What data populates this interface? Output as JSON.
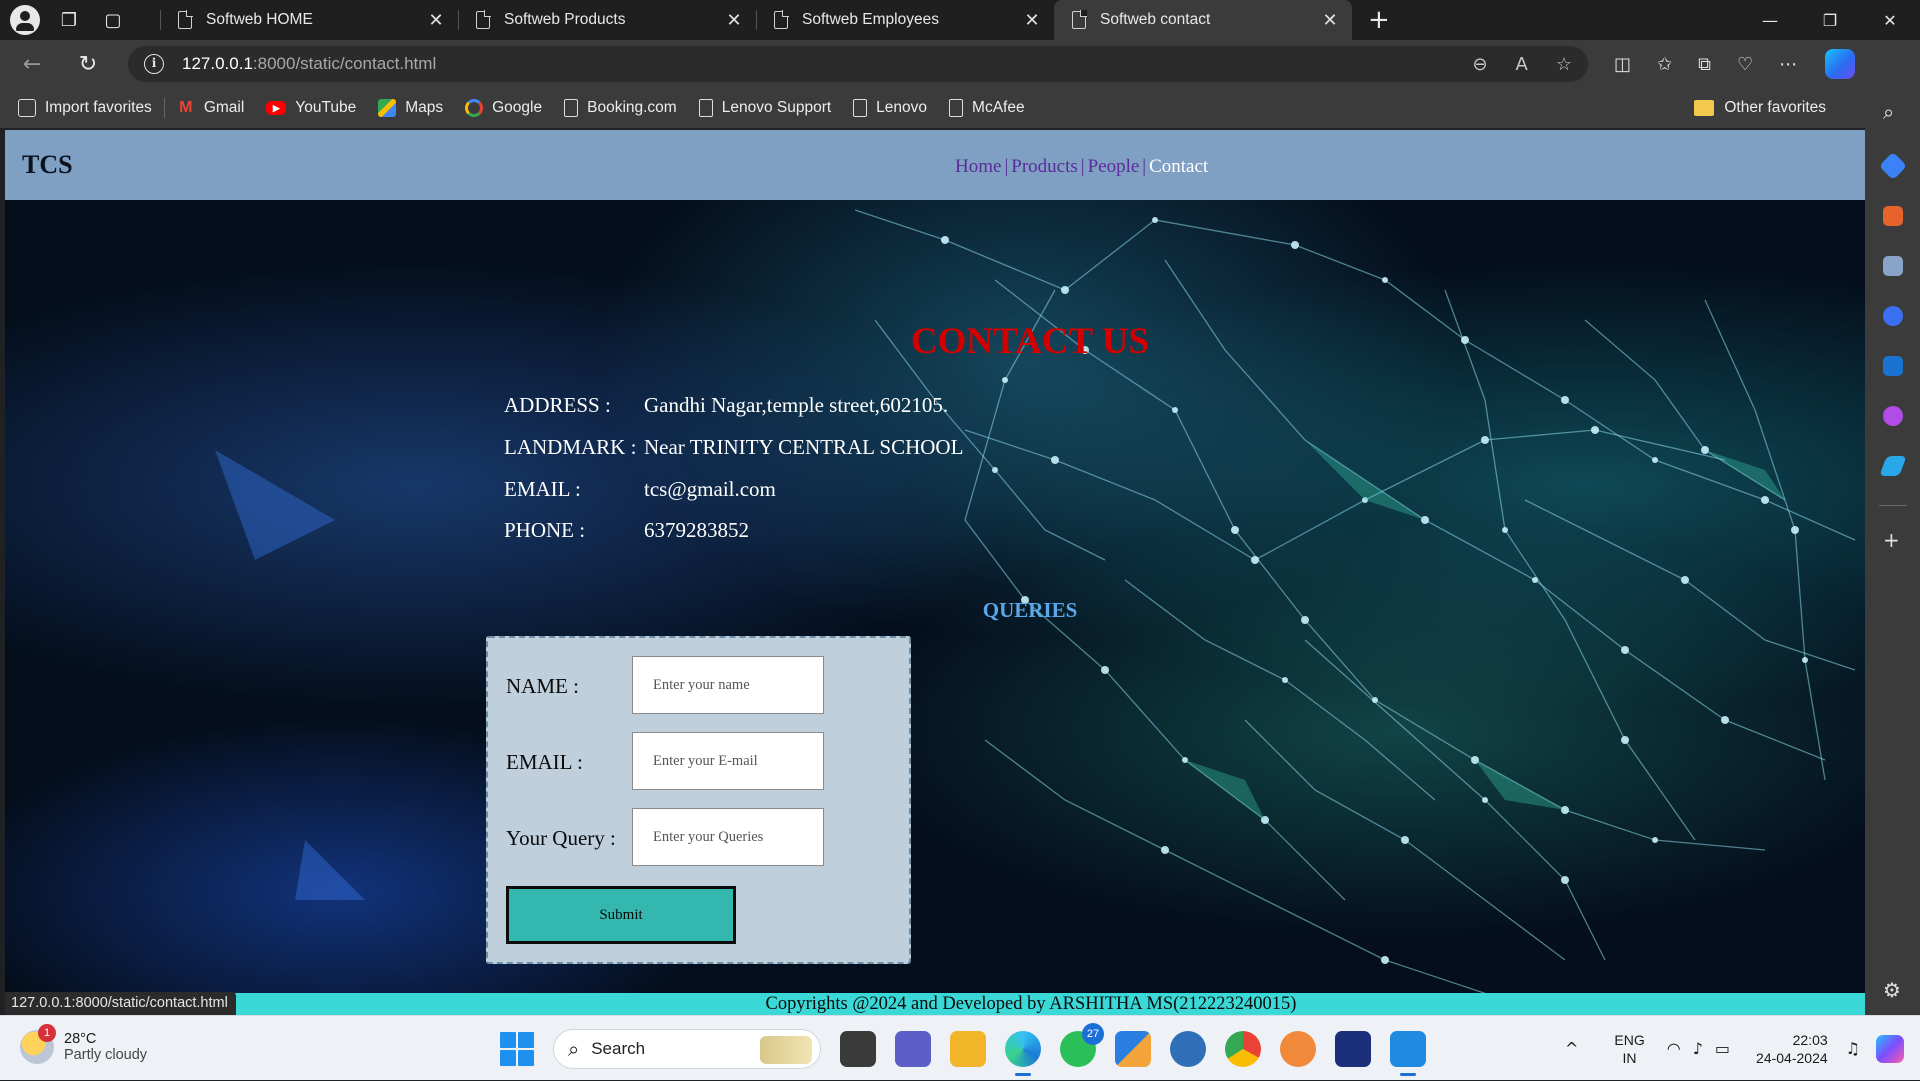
{
  "browser": {
    "tabs": [
      {
        "title": "Softweb HOME"
      },
      {
        "title": "Softweb Products"
      },
      {
        "title": "Softweb Employees"
      },
      {
        "title": "Softweb contact"
      }
    ],
    "url_host": "127.0.0.1",
    "url_path": ":8000/static/contact.html",
    "favorites": [
      {
        "label": "Import favorites",
        "icon": "import-icon"
      },
      {
        "label": "Gmail",
        "icon": "gmail-icon"
      },
      {
        "label": "YouTube",
        "icon": "youtube-icon"
      },
      {
        "label": "Maps",
        "icon": "maps-icon"
      },
      {
        "label": "Google",
        "icon": "google-icon"
      },
      {
        "label": "Booking.com",
        "icon": "page-icon"
      },
      {
        "label": "Lenovo Support",
        "icon": "page-icon"
      },
      {
        "label": "Lenovo",
        "icon": "page-icon"
      },
      {
        "label": "McAfee",
        "icon": "page-icon"
      }
    ],
    "other_favorites": "Other favorites",
    "status_url": "127.0.0.1:8000/static/contact.html"
  },
  "site": {
    "logo": "TCS",
    "menu": [
      {
        "label": "Home"
      },
      {
        "label": "Products"
      },
      {
        "label": "People"
      },
      {
        "label": "Contact"
      }
    ],
    "separator": "|",
    "contact_title": "CONTACT US",
    "info": [
      {
        "label": "ADDRESS :",
        "value": "Gandhi Nagar,temple street,602105."
      },
      {
        "label": "LANDMARK :",
        "value": "Near TRINITY CENTRAL SCHOOL"
      },
      {
        "label": "EMAIL :",
        "value": "tcs@gmail.com"
      },
      {
        "label": "PHONE :",
        "value": "6379283852"
      }
    ],
    "queries_title": "QUERIES",
    "form": {
      "name_label": "NAME :",
      "name_placeholder": "Enter your name",
      "email_label": "EMAIL :",
      "email_placeholder": "Enter your E-mail",
      "query_label": "Your Query :",
      "query_placeholder": "Enter your Queries",
      "submit_label": "Submit"
    },
    "footer": "Copyrights @2024 and Developed by ARSHITHA MS(212223240015)"
  },
  "colors": {
    "header_bg": "#7f9fc3",
    "title_red": "#d40000",
    "menu_purple": "#5a2d9a",
    "queries_blue": "#5aa8ea",
    "submit_teal": "#34b7ae",
    "footer_cyan": "#3bd8d8"
  },
  "taskbar": {
    "weather_temp": "28°C",
    "weather_desc": "Partly cloudy",
    "weather_badge": "1",
    "search_label": "Search",
    "whatsapp_count": "27",
    "lang_top": "ENG",
    "lang_bottom": "IN",
    "time": "22:03",
    "date": "24-04-2024"
  }
}
